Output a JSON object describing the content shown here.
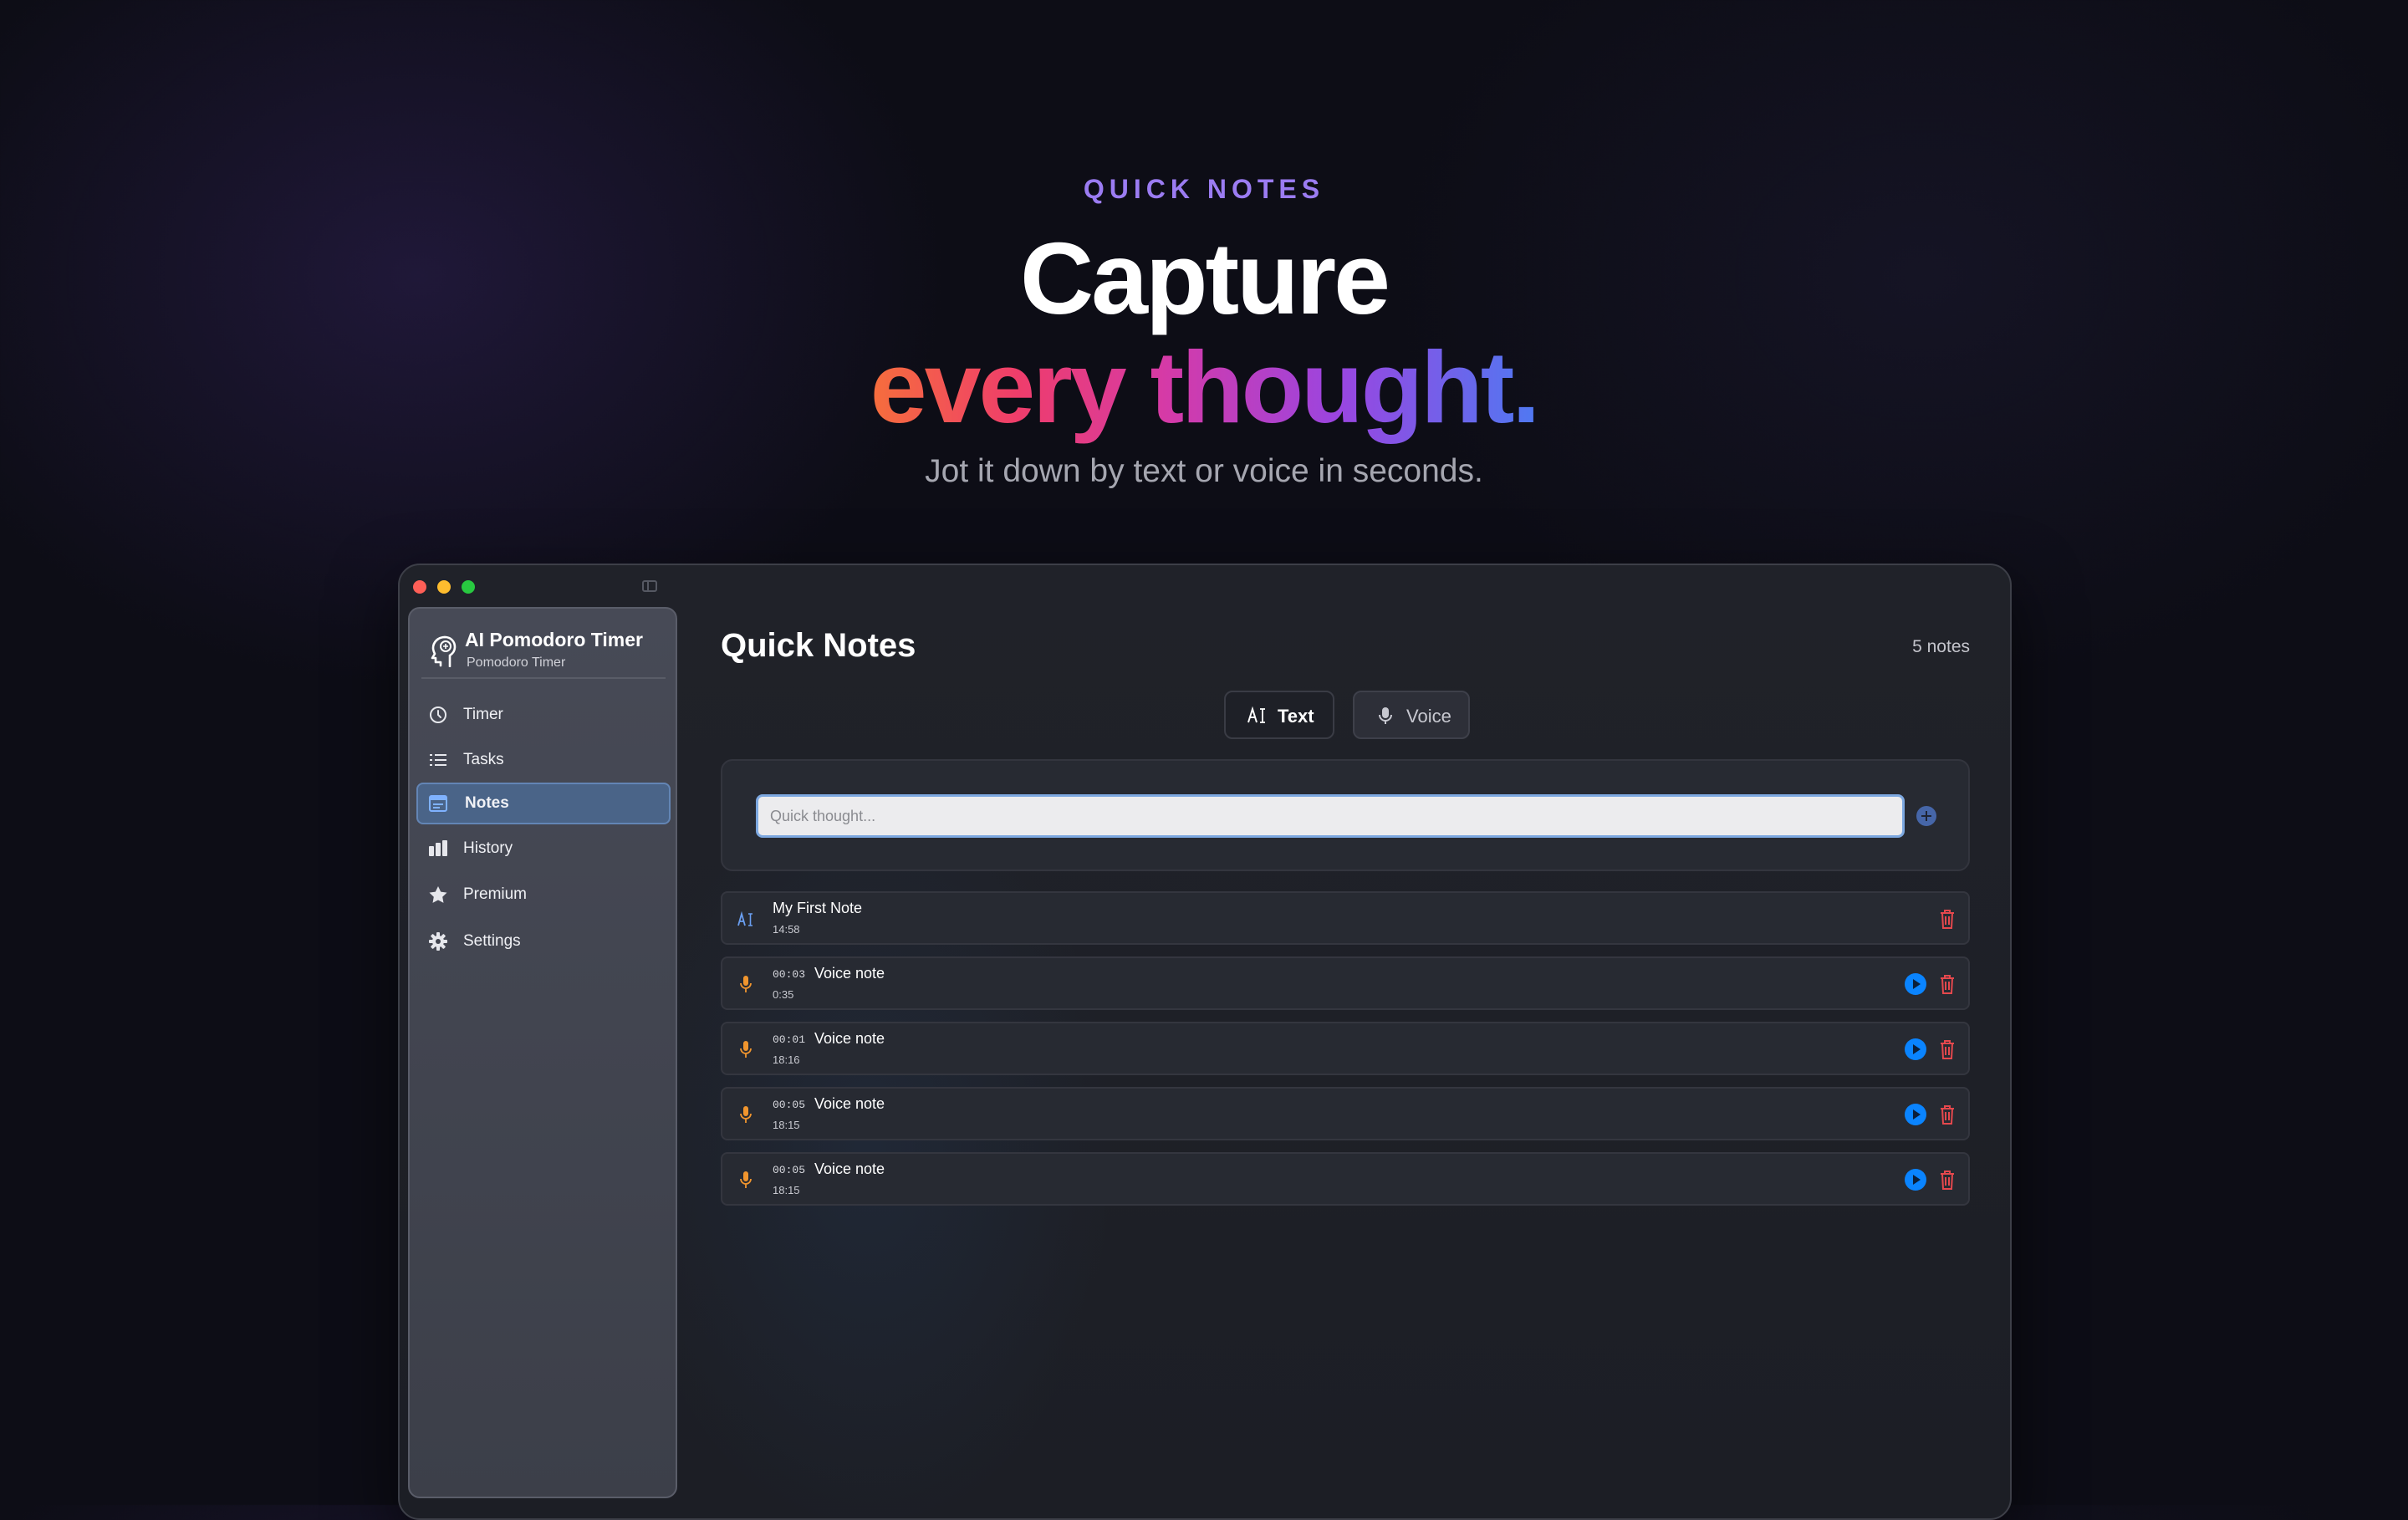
{
  "hero": {
    "eyebrow": "QUICK NOTES",
    "headline_line1": "Capture",
    "headline_line2": "every thought.",
    "subtitle": "Jot it down by text or voice in seconds."
  },
  "sidebar": {
    "app_title": "AI Pomodoro Timer",
    "app_subtitle": "Pomodoro Timer",
    "items": [
      {
        "label": "Timer",
        "icon": "timer-icon"
      },
      {
        "label": "Tasks",
        "icon": "list-icon"
      },
      {
        "label": "Notes",
        "icon": "notes-icon",
        "active": true
      },
      {
        "label": "History",
        "icon": "bar-chart-icon"
      },
      {
        "label": "Premium",
        "icon": "star-icon"
      },
      {
        "label": "Settings",
        "icon": "gear-icon"
      }
    ]
  },
  "main": {
    "title": "Quick Notes",
    "count": "5 notes",
    "modes": {
      "text": "Text",
      "voice": "Voice",
      "selected": "text"
    },
    "input": {
      "placeholder": "Quick thought...",
      "value": ""
    },
    "notes": [
      {
        "type": "text",
        "title": "My First Note",
        "time": "14:58"
      },
      {
        "type": "voice",
        "duration": "00:03",
        "title": "Voice note",
        "time": "0:35"
      },
      {
        "type": "voice",
        "duration": "00:01",
        "title": "Voice note",
        "time": "18:16"
      },
      {
        "type": "voice",
        "duration": "00:05",
        "title": "Voice note",
        "time": "18:15"
      },
      {
        "type": "voice",
        "duration": "00:05",
        "title": "Voice note",
        "time": "18:15"
      }
    ]
  },
  "colors": {
    "accent_purple": "#9b7cf2",
    "active_nav": "#4a6488",
    "play_blue": "#0a84ff",
    "delete_red": "#e5484d",
    "mic_orange": "#f0952e"
  }
}
